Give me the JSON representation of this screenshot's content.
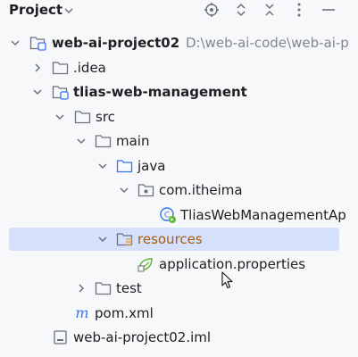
{
  "header": {
    "title": "Project"
  },
  "tree": {
    "root": {
      "label": "web-ai-project02",
      "path": "D:\\web-ai-code\\web-ai-p"
    },
    "idea": {
      "label": ".idea"
    },
    "module": {
      "label": "tlias-web-management"
    },
    "src": {
      "label": "src"
    },
    "main": {
      "label": "main"
    },
    "java": {
      "label": "java"
    },
    "package": {
      "label": "com.itheima"
    },
    "app_class": {
      "label": "TliasWebManagementAp"
    },
    "resources": {
      "label": "resources"
    },
    "properties": {
      "label": "application.properties"
    },
    "test": {
      "label": "test"
    },
    "pom": {
      "label": "pom.xml"
    },
    "iml": {
      "label": "web-ai-project02.iml"
    }
  },
  "colors": {
    "selection": "#d5e1fb",
    "folder_icon": "#6c707e",
    "source_folder_icon": "#3574f0",
    "resources_accent": "#e8a33d",
    "spring_green": "#5fb832"
  }
}
